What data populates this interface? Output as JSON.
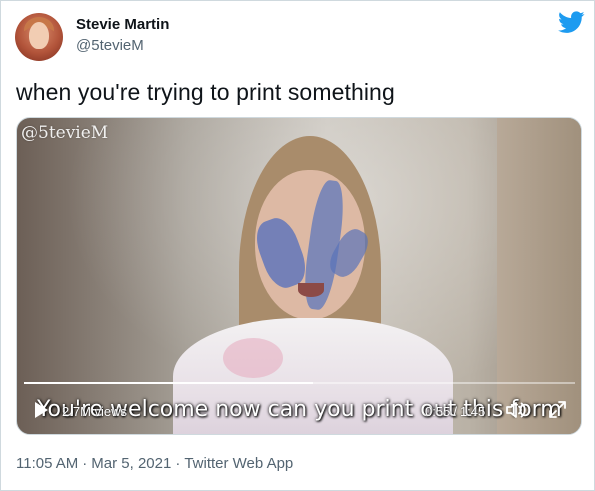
{
  "author": {
    "name": "Stevie Martin",
    "handle": "@5tevieM"
  },
  "tweet": {
    "text": "when you're trying to print something"
  },
  "video": {
    "watermark": "@5tevieM",
    "caption": "You're welcome now can you print out this form",
    "views": "2.7M views",
    "current_time": "0:55",
    "separator": "/",
    "duration": "1:45",
    "progress_fraction": 0.524
  },
  "meta": {
    "time": "11:05 AM",
    "dot1": "·",
    "date": "Mar 5, 2021",
    "dot2": "·",
    "source": "Twitter Web App"
  },
  "icons": {
    "logo": "twitter-bird-icon",
    "play": "play-icon",
    "volume": "volume-icon",
    "expand": "expand-icon"
  },
  "colors": {
    "brand": "#1d9bf0",
    "text": "#0f1419",
    "muted": "#536471"
  }
}
